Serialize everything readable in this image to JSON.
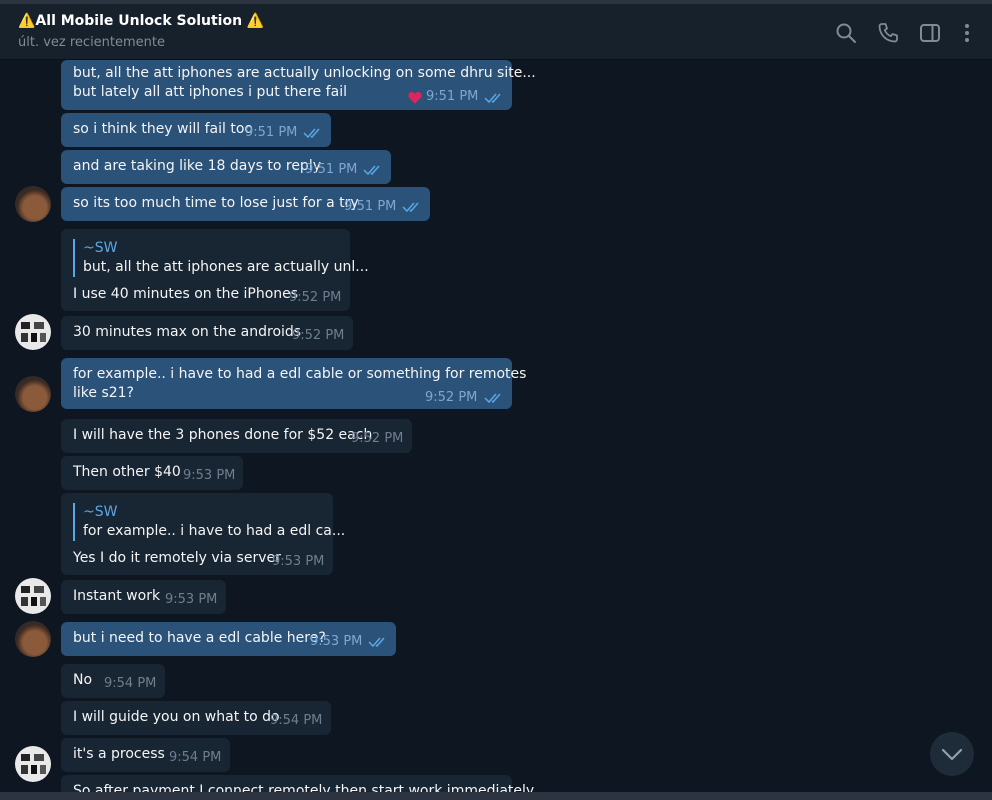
{
  "header": {
    "title": "⚠️All Mobile Unlock Solution ⚠️",
    "status": "últ. vez recientemente",
    "icons": [
      "search-icon",
      "phone-icon",
      "sidebar-icon",
      "more-vertical-icon"
    ]
  },
  "colors": {
    "background": "#0e1621",
    "header": "#17212b",
    "incoming_bubble": "#182533",
    "outgoing_bubble": "#2b5278",
    "accent": "#5aa7e6"
  },
  "messages": [
    {
      "from": "out",
      "lines": [
        "but, all the att iphones are actually unlocking on some dhru site...",
        "but lately all att iphones i put there fail"
      ],
      "time": "9:51 PM",
      "reaction": "heart"
    },
    {
      "from": "out",
      "lines": [
        "so i think they will fail too"
      ],
      "time": "9:51 PM"
    },
    {
      "from": "out",
      "lines": [
        "and are taking like 18 days to reply"
      ],
      "time": "9:51 PM"
    },
    {
      "from": "out",
      "lines": [
        "so its too much time to lose just for a try"
      ],
      "time": "9:51 PM"
    },
    {
      "from": "in",
      "reply": {
        "name": "~SW",
        "text": "but, all the att iphones are actually unl..."
      },
      "lines": [
        "I use 40 minutes on the iPhones"
      ],
      "time": "9:52 PM"
    },
    {
      "from": "in",
      "lines": [
        "30 minutes max on the androids"
      ],
      "time": "9:52 PM"
    },
    {
      "from": "out",
      "lines": [
        "for example.. i have to had a edl cable or something for remotes",
        "like s21?"
      ],
      "time": "9:52 PM"
    },
    {
      "from": "in",
      "lines": [
        "I will have the 3 phones done for $52 each"
      ],
      "time": "9:52 PM"
    },
    {
      "from": "in",
      "lines": [
        "Then other $40"
      ],
      "time": "9:53 PM"
    },
    {
      "from": "in",
      "reply": {
        "name": "~SW",
        "text": "for example.. i have to had a edl ca..."
      },
      "lines": [
        "Yes I do it remotely via server"
      ],
      "time": "9:53 PM"
    },
    {
      "from": "in",
      "lines": [
        "Instant work"
      ],
      "time": "9:53 PM"
    },
    {
      "from": "out",
      "lines": [
        "but i need to have a edl cable here?"
      ],
      "time": "9:53 PM"
    },
    {
      "from": "in",
      "lines": [
        "No"
      ],
      "time": "9:54 PM"
    },
    {
      "from": "in",
      "lines": [
        "I will guide you on what to do"
      ],
      "time": "9:54 PM"
    },
    {
      "from": "in",
      "lines": [
        "it's a process"
      ],
      "time": "9:54 PM"
    },
    {
      "from": "in",
      "lines": [
        "So after payment I connect remotely then start work immediately"
      ]
    }
  ]
}
